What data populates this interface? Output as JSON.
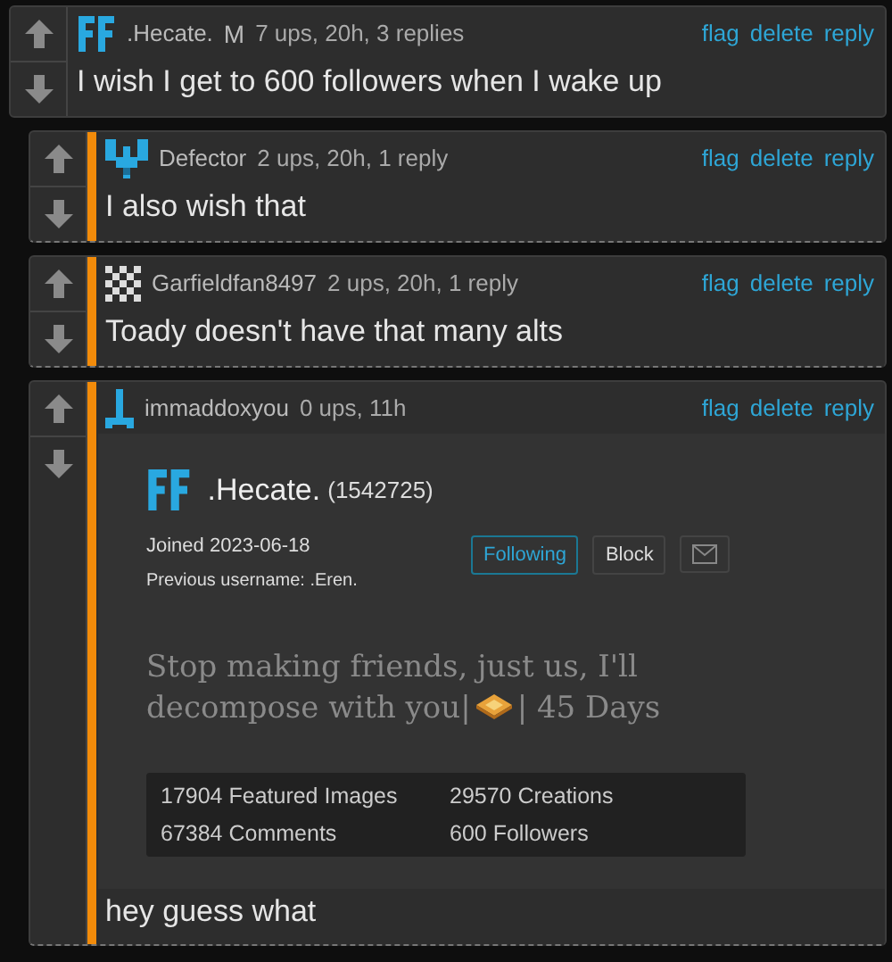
{
  "comments": [
    {
      "kind": "ff",
      "user": ".Hecate.",
      "badge": "M",
      "meta": "7 ups, 20h, 3 replies",
      "actions": [
        "flag",
        "delete",
        "reply"
      ],
      "body": "I wish I get to 600 followers when I wake up",
      "children": [
        {
          "kind": "pixel",
          "user": "Defector",
          "meta": "2 ups, 20h, 1 reply",
          "actions": [
            "flag",
            "delete",
            "reply"
          ],
          "body": "I also wish that"
        },
        {
          "kind": "checker",
          "user": "Garfieldfan8497",
          "meta": "2 ups, 20h, 1 reply",
          "actions": [
            "flag",
            "delete",
            "reply"
          ],
          "body": "Toady doesn't have that many alts"
        },
        {
          "kind": "stick",
          "user": "immaddoxyou",
          "meta": "0 ups, 11h",
          "actions": [
            "flag",
            "delete",
            "reply"
          ],
          "profile": {
            "name": ".Hecate.",
            "id": "(1542725)",
            "joined": "Joined 2023-06-18",
            "previous": "Previous username: .Eren.",
            "buttons": [
              {
                "label": "Following",
                "selected": true
              },
              {
                "label": "Block",
                "selected": false
              }
            ],
            "bio_before": "Stop making friends, just us, I'll decompose with you|",
            "bio_after": "| 45 Days",
            "stats": [
              "17904 Featured Images",
              "29570 Creations",
              "67384 Comments",
              "600 Followers"
            ]
          },
          "body": "hey guess what"
        }
      ]
    }
  ]
}
